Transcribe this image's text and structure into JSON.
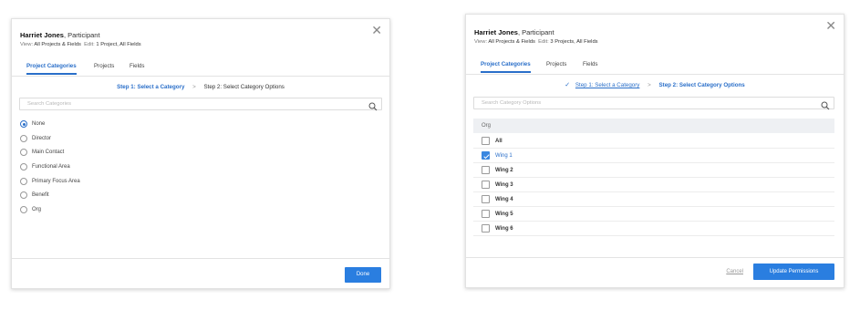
{
  "modal1": {
    "close_glyph": "✕",
    "header": {
      "name": "Harriet Jones",
      "role": ", Participant",
      "view_label": "View:",
      "view_value": "All Projects & Fields",
      "edit_label": "Edit:",
      "edit_value": "1 Project, All Fields"
    },
    "tabs": [
      {
        "label": "Project Categories",
        "active": true
      },
      {
        "label": "Projects",
        "active": false
      },
      {
        "label": "Fields",
        "active": false
      }
    ],
    "steps": {
      "step1": "Step 1: Select a Category",
      "separator": ">",
      "step2": "Step 2: Select Category Options"
    },
    "search": {
      "placeholder": "Search Categories",
      "icon": "search-icon"
    },
    "options": [
      {
        "label": "None",
        "selected": true
      },
      {
        "label": "Director",
        "selected": false
      },
      {
        "label": "Main Contact",
        "selected": false
      },
      {
        "label": "Functional Area",
        "selected": false
      },
      {
        "label": "Primary Focus Area",
        "selected": false
      },
      {
        "label": "Benefit",
        "selected": false
      },
      {
        "label": "Org",
        "selected": false
      }
    ],
    "done_label": "Done"
  },
  "modal2": {
    "close_glyph": "✕",
    "header": {
      "name": "Harriet Jones",
      "role": ", Participant",
      "view_label": "View:",
      "view_value": "All Projects & Fields",
      "edit_label": "Edit:",
      "edit_value": "3 Projects, All Fields"
    },
    "tabs": [
      {
        "label": "Project Categories",
        "active": true
      },
      {
        "label": "Projects",
        "active": false
      },
      {
        "label": "Fields",
        "active": false
      }
    ],
    "steps": {
      "check_glyph": "✓",
      "step1": "Step 1: Select a Category",
      "separator": ">",
      "step2": "Step 2: Select Category Options"
    },
    "search": {
      "placeholder": "Search Category Options",
      "icon": "search-icon"
    },
    "group_header": "Org",
    "options": [
      {
        "label": "All",
        "checked": false
      },
      {
        "label": "Wing 1",
        "checked": true
      },
      {
        "label": "Wing 2",
        "checked": false
      },
      {
        "label": "Wing 3",
        "checked": false
      },
      {
        "label": "Wing 4",
        "checked": false
      },
      {
        "label": "Wing 5",
        "checked": false
      },
      {
        "label": "Wing 6",
        "checked": false
      }
    ],
    "cancel_label": "Cancel",
    "update_label": "Update Permissions"
  },
  "colors": {
    "accent": "#2a6fc9",
    "button": "#2a7ee0"
  }
}
